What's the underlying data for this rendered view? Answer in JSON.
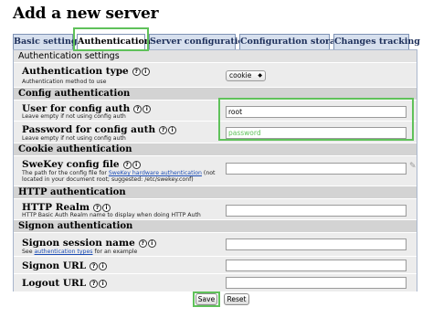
{
  "page_title": "Add a new server",
  "tabs": [
    {
      "label": "Basic settings"
    },
    {
      "label": "Authentication"
    },
    {
      "label": "Server configuration"
    },
    {
      "label": "Configuration storage"
    },
    {
      "label": "Changes tracking"
    }
  ],
  "settings_header": "Authentication settings",
  "auth_type": {
    "label": "Authentication type",
    "desc": "Authentication method to use",
    "value": "cookie"
  },
  "sections": {
    "config": "Config authentication",
    "cookie": "Cookie authentication",
    "http": "HTTP authentication",
    "signon": "Signon authentication"
  },
  "config_user": {
    "label": "User for config auth",
    "desc": "Leave empty if not using config auth",
    "value": "root"
  },
  "config_pass": {
    "label": "Password for config auth",
    "desc": "Leave empty if not using config auth",
    "value": "password"
  },
  "swekey": {
    "label": "SweKey config file",
    "desc_pre": "The path for the config file for ",
    "desc_link": "SweKey hardware authentication",
    "desc_post": " (not",
    "desc_line2": "located in your document root; suggested: /etc/swekey.conf)",
    "value": ""
  },
  "http_realm": {
    "label": "HTTP Realm",
    "desc": "HTTP Basic Auth Realm name to display when doing HTTP Auth",
    "value": ""
  },
  "signon_session": {
    "label": "Signon session name",
    "desc_pre": "See ",
    "desc_link": "authentication types",
    "desc_post": " for an example",
    "value": ""
  },
  "signon_url": {
    "label": "Signon URL",
    "value": ""
  },
  "logout_url": {
    "label": "Logout URL",
    "value": ""
  },
  "buttons": {
    "save": "Save",
    "reset": "Reset"
  },
  "help_glyphs": {
    "doc": "?",
    "info": "i"
  },
  "colors": {
    "highlight": "#5fc15a",
    "tab_bg": "#d7e0ee",
    "section_bg": "#d3d3d3",
    "field_bg": "#ececec"
  }
}
